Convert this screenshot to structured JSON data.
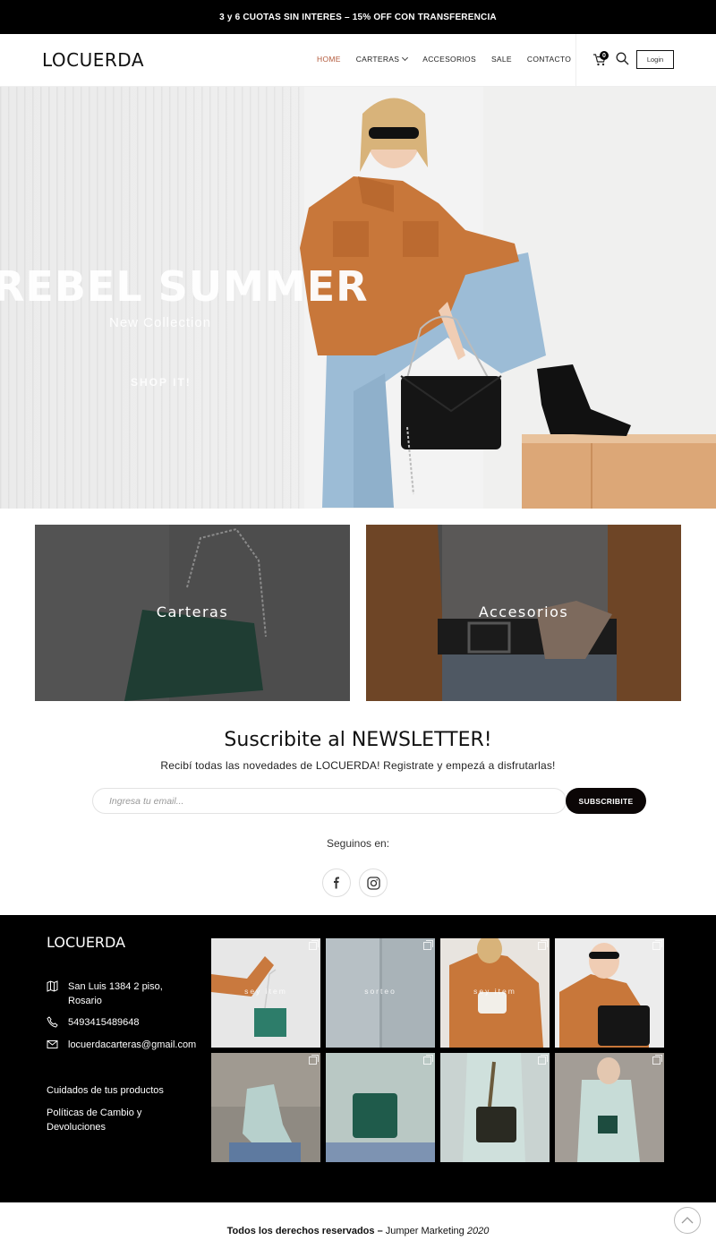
{
  "topbar": {
    "text": "3 y 6 CUOTAS SIN INTERES – 15% OFF CON TRANSFERENCIA"
  },
  "header": {
    "logo": "LOCUERDA",
    "nav": [
      {
        "label": "HOME",
        "active": true
      },
      {
        "label": "CARTERAS",
        "dropdown": true
      },
      {
        "label": "ACCESORIOS"
      },
      {
        "label": "SALE"
      },
      {
        "label": "CONTACTO"
      }
    ],
    "cart_count": "0",
    "login_label": "Login"
  },
  "hero": {
    "title": "REBEL SUMMER",
    "subtitle": "New Collection",
    "cta": "SHOP IT!"
  },
  "categories": [
    {
      "label": "Carteras"
    },
    {
      "label": "Accesorios"
    }
  ],
  "newsletter": {
    "title": "Suscribite al NEWSLETTER!",
    "subtitle": "Recibí todas las novedades de LOCUERDA! Registrate y empezá a disfrutarlas!",
    "placeholder": "Ingresa tu email...",
    "button": "SUBSCRIBITE",
    "follow": "Seguinos en:"
  },
  "footer": {
    "logo": "LOCUERDA",
    "address_line1": "San Luis 1384 2 piso,",
    "address_line2": "Rosario",
    "phone": "5493415489648",
    "email": "locuerdacarteras@gmail.com",
    "link1": "Cuidados de tus productos",
    "link2_line1": "Políticas de Cambio y",
    "link2_line2": "Devoluciones",
    "instagram_overlays": [
      "sey item",
      "sorteo",
      "sey item"
    ]
  },
  "copyright": {
    "bold": "Todos los derechos reservados –",
    "plain": "Jumper Marketing",
    "year": "2020"
  },
  "colors": {
    "accent": "#b35a3c",
    "black": "#000000",
    "jacket": "#c8773a",
    "denim": "#9cbcd6"
  }
}
